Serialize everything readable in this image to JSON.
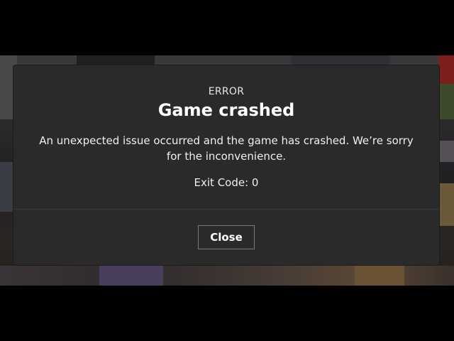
{
  "dialog": {
    "eyebrow": "ERROR",
    "title": "Game crashed",
    "message": "An unexpected issue occurred and the game has crashed. We’re sorry for the inconvenience.",
    "exit_code": "Exit Code: 0",
    "close_label": "Close"
  },
  "colors": {
    "dialog_background": "#2a2a2a",
    "button_border": "#7a7a7a",
    "title_text": "#ffffff"
  }
}
